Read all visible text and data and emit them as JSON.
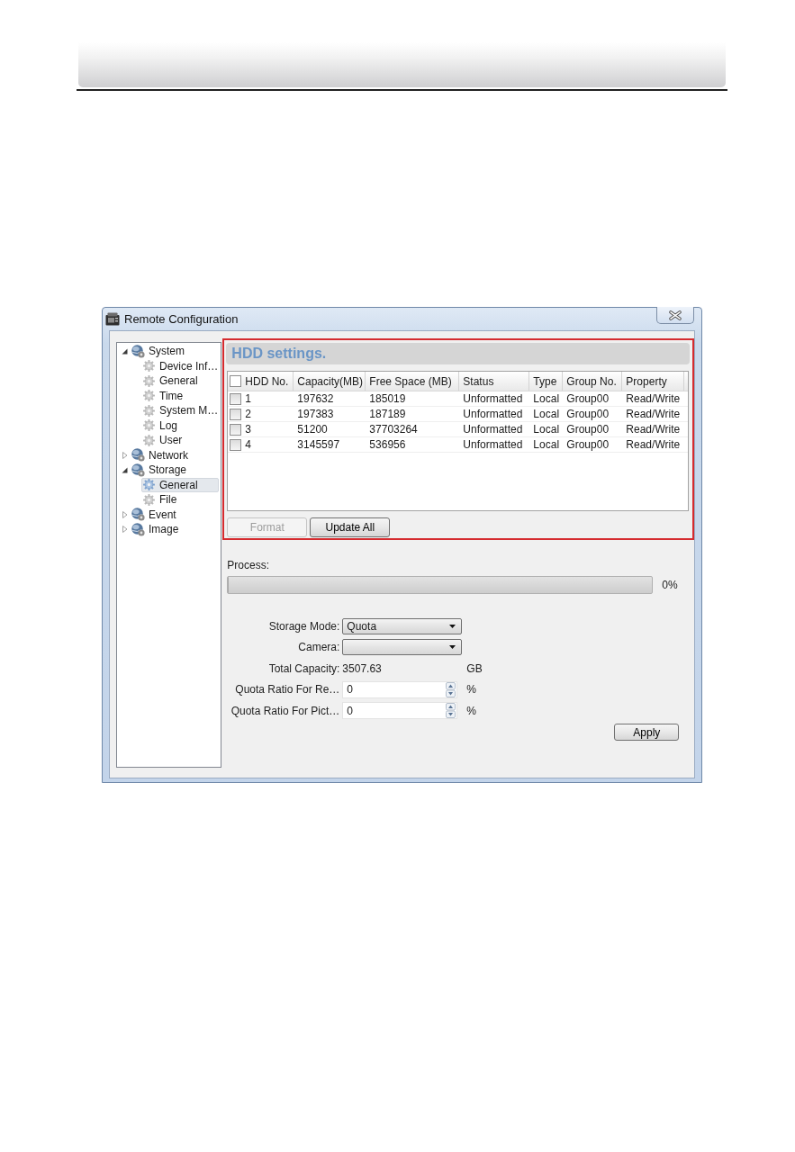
{
  "window": {
    "title": "Remote Configuration"
  },
  "tree": [
    {
      "label": "System",
      "expanded": true,
      "selected": false,
      "children": [
        {
          "label": "Device Inf…",
          "selected": false
        },
        {
          "label": "General",
          "selected": false
        },
        {
          "label": "Time",
          "selected": false
        },
        {
          "label": "System M…",
          "selected": false
        },
        {
          "label": "Log",
          "selected": false
        },
        {
          "label": "User",
          "selected": false
        }
      ]
    },
    {
      "label": "Network",
      "expanded": false,
      "selected": false
    },
    {
      "label": "Storage",
      "expanded": true,
      "selected": false,
      "children": [
        {
          "label": "General",
          "selected": true
        },
        {
          "label": "File",
          "selected": false
        }
      ]
    },
    {
      "label": "Event",
      "expanded": false,
      "selected": false
    },
    {
      "label": "Image",
      "expanded": false,
      "selected": false
    }
  ],
  "hdd_settings": {
    "title": "HDD settings.",
    "highlighted": true,
    "table": {
      "header_checkbox": {
        "checked": false
      },
      "columns": [
        "HDD No.",
        "Capacity(MB)",
        "Free Space (MB)",
        "Status",
        "Type",
        "Group No.",
        "Property"
      ],
      "rows": [
        {
          "checked": false,
          "cells": [
            "1",
            "197632",
            "185019",
            "Unformatted",
            "Local",
            "Group00",
            "Read/Write"
          ]
        },
        {
          "checked": false,
          "cells": [
            "2",
            "197383",
            "187189",
            "Unformatted",
            "Local",
            "Group00",
            "Read/Write"
          ]
        },
        {
          "checked": false,
          "cells": [
            "3",
            "51200",
            "37703264",
            "Unformatted",
            "Local",
            "Group00",
            "Read/Write"
          ]
        },
        {
          "checked": false,
          "cells": [
            "4",
            "3145597",
            "536956",
            "Unformatted",
            "Local",
            "Group00",
            "Read/Write"
          ]
        }
      ]
    },
    "buttons": [
      {
        "label": "Format",
        "disabled": true
      },
      {
        "label": "Update All",
        "disabled": false
      }
    ]
  },
  "process": {
    "label": "Process:",
    "level": 0,
    "reading": "0%"
  },
  "form": [
    {
      "kind": "select",
      "label": "Storage Mode:",
      "value": "Quota"
    },
    {
      "kind": "select",
      "label": "Camera:"
    },
    {
      "kind": "text",
      "label": "Total Capacity:",
      "value": "3507.63",
      "unit": "GB"
    },
    {
      "kind": "spin",
      "label": "Quota Ratio For Re…",
      "value": "0",
      "unit": "%"
    },
    {
      "kind": "spin",
      "label": "Quota Ratio For Pict…",
      "value": "0",
      "unit": "%"
    }
  ],
  "apply_button": {
    "label": "Apply"
  }
}
